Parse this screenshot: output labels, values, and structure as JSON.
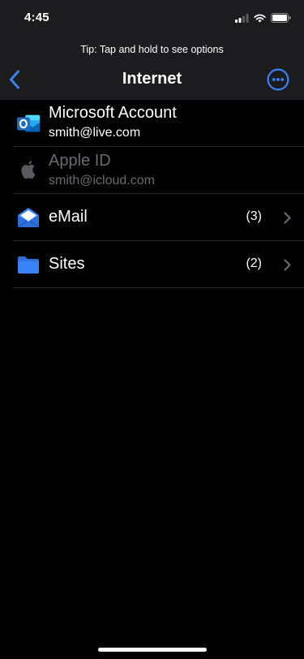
{
  "status_bar": {
    "time": "4:45"
  },
  "tip": "Tip: Tap and hold to see options",
  "nav": {
    "title": "Internet",
    "back_icon": "chevron-left-icon",
    "more_icon": "ellipsis-circle-icon"
  },
  "accounts": [
    {
      "title": "Microsoft Account",
      "subtitle": "smith@live.com",
      "icon": "outlook-icon",
      "dimmed": false
    },
    {
      "title": "Apple ID",
      "subtitle": "smith@icloud.com",
      "icon": "apple-icon",
      "dimmed": true
    }
  ],
  "categories": [
    {
      "title": "eMail",
      "count": "(3)",
      "icon": "envelope-open-icon"
    },
    {
      "title": "Sites",
      "count": "(2)",
      "icon": "folder-icon"
    }
  ],
  "colors": {
    "accent": "#3a82f7",
    "header_background": "#1c1c1e",
    "background": "#000000",
    "separator": "#2c2c2e",
    "dimmed_text": "#6a6a6d",
    "outlook_blue": "#1b6ec2"
  }
}
